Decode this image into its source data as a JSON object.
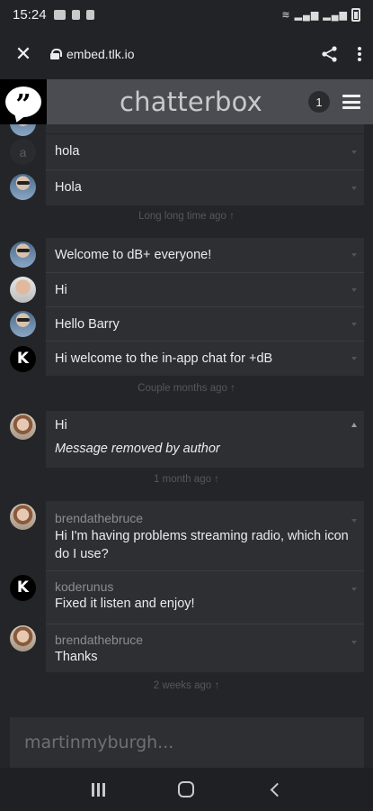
{
  "status_bar": {
    "time": "15:24"
  },
  "browser": {
    "url": "embed.tlk.io"
  },
  "header": {
    "brand": "chatterbox",
    "count": "1"
  },
  "messages": {
    "hola_lower": "hola",
    "hola_upper": "Hola",
    "sep1": "Long long time ago ↑",
    "welcome": "Welcome to dB+ everyone!",
    "hi1": "Hi",
    "hello_barry": "Hello Barry",
    "hi_welcome": "Hi welcome to the in-app chat for +dB",
    "sep2": "Couple months ago ↑",
    "hi2": "Hi",
    "removed": "Message removed by author",
    "sep3": "1 month ago ↑",
    "user_brenda": "brendathebruce",
    "problem": "Hi I'm having problems streaming radio, which icon do I use?",
    "user_koder": "koderunus",
    "fixed": "Fixed it listen and enjoy!",
    "thanks": "Thanks",
    "sep4": "2 weeks ago ↑"
  },
  "composer": {
    "placeholder": "martinmyburgh..."
  },
  "icons": {
    "close": "close-icon",
    "lock": "lock-icon",
    "share": "share-icon",
    "more": "more-vert-icon",
    "logo": "chatterbox-logo-icon",
    "menu": "hamburger-menu-icon",
    "nav_recents": "recents-icon",
    "nav_home": "home-icon",
    "nav_back": "back-icon"
  }
}
